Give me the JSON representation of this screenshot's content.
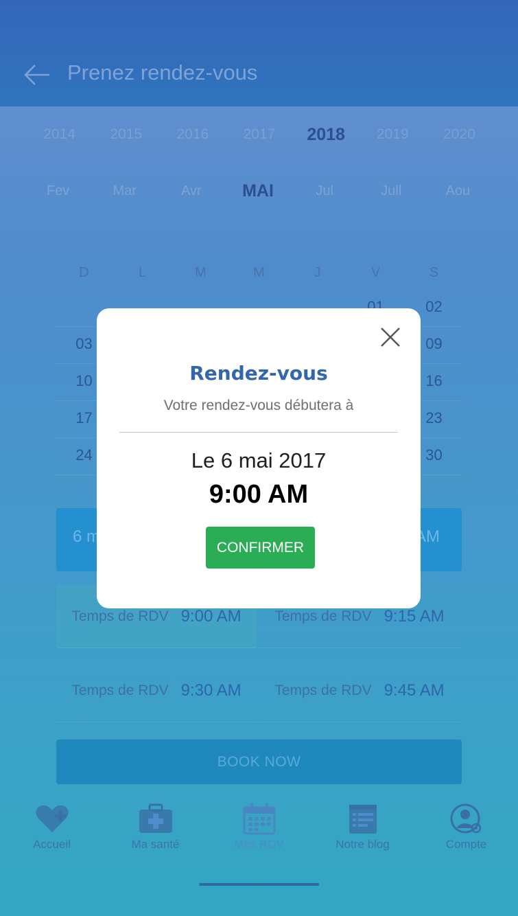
{
  "header": {
    "title": "Prenez rendez-vous",
    "back_icon": "arrow-left-icon"
  },
  "years": {
    "items": [
      "2014",
      "2015",
      "2016",
      "2017",
      "2018",
      "2019",
      "2020"
    ],
    "selected": "2018"
  },
  "months": {
    "items": [
      "Fev",
      "Mar",
      "Avr",
      "MAI",
      "Jul",
      "Jull",
      "Aou"
    ],
    "selected": "MAI"
  },
  "calendar": {
    "weekdays": [
      "D",
      "L",
      "M",
      "M",
      "J",
      "V",
      "S"
    ],
    "rows": [
      [
        "",
        "",
        "",
        "",
        "",
        "01",
        "02"
      ],
      [
        "03",
        "",
        "",
        "",
        "",
        "",
        "09"
      ],
      [
        "10",
        "",
        "",
        "",
        "",
        "",
        "16"
      ],
      [
        "17",
        "",
        "",
        "",
        "",
        "",
        "23"
      ],
      [
        "24",
        "",
        "",
        "",
        "",
        "",
        "30"
      ]
    ]
  },
  "selected_date_bar": {
    "left_text": "6 m",
    "right_text": "AM"
  },
  "slots": [
    {
      "label": "Temps de RDV",
      "time": "9:00 AM",
      "active": true
    },
    {
      "label": "Temps de RDV",
      "time": "9:15 AM",
      "active": false
    },
    {
      "label": "Temps de RDV",
      "time": "9:30 AM",
      "active": false
    },
    {
      "label": "Temps de RDV",
      "time": "9:45 AM",
      "active": false
    }
  ],
  "book_button": "BOOK NOW",
  "nav": [
    {
      "label": "Accueil",
      "icon": "heart-plus-icon"
    },
    {
      "label": "Ma santé",
      "icon": "medical-kit-icon"
    },
    {
      "label": "Mes RDV",
      "icon": "calendar-icon"
    },
    {
      "label": "Notre blog",
      "icon": "blog-icon"
    },
    {
      "label": "Compte",
      "icon": "account-settings-icon"
    }
  ],
  "modal": {
    "title": "Rendez-vous",
    "subtitle": "Votre rendez-vous débutera à",
    "date": "Le 6 mai 2017",
    "time": "9:00 AM",
    "confirm_label": "CONFIRMER",
    "close_icon": "close-icon"
  },
  "colors": {
    "header": "#3566b8",
    "primary_text": "#3267ad",
    "confirm": "#2bad55",
    "book": "#1f88bd"
  }
}
